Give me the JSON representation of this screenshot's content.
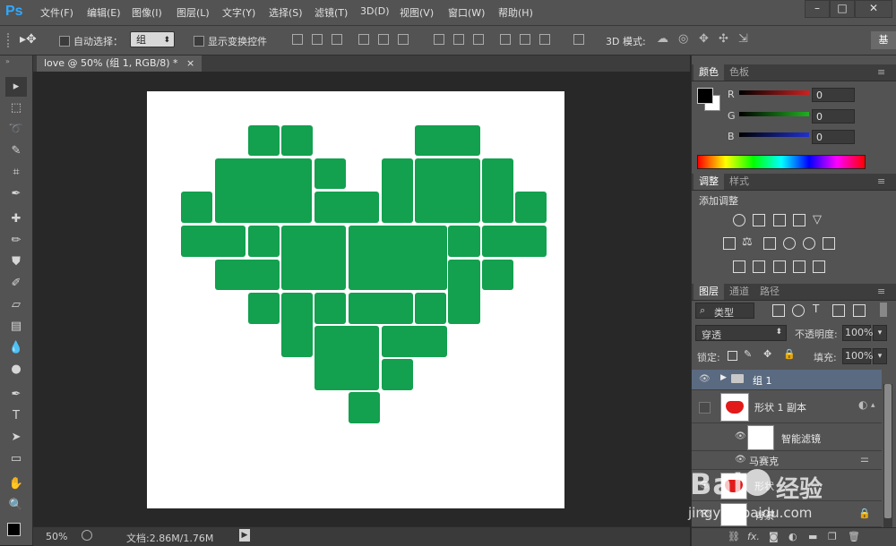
{
  "app": {
    "logo": "Ps",
    "menu": [
      "文件(F)",
      "编辑(E)",
      "图像(I)",
      "图层(L)",
      "文字(Y)",
      "选择(S)",
      "滤镜(T)",
      "3D(D)",
      "视图(V)",
      "窗口(W)",
      "帮助(H)"
    ],
    "window_controls": [
      "–",
      "□",
      "✕"
    ]
  },
  "options_bar": {
    "auto_select_label": "自动选择：",
    "auto_select_value": "组",
    "transform_controls_label": "显示变换控件",
    "mode_3d_label": "3D 模式:",
    "workspace_label": "基"
  },
  "document": {
    "tab_title": "love @ 50% (组 1, RGB/8) *",
    "tab_close": "×",
    "canvas_fill_color": "#13a04f",
    "zoom": "50%",
    "doc_size": "文档:2.86M/1.76M"
  },
  "color_panel": {
    "tabs": [
      "颜色",
      "色板"
    ],
    "channels": [
      {
        "label": "R",
        "value": "0",
        "color": "#d02020"
      },
      {
        "label": "G",
        "value": "0",
        "color": "#20b020"
      },
      {
        "label": "B",
        "value": "0",
        "color": "#2030d0"
      }
    ]
  },
  "adjustments_panel": {
    "tabs": [
      "调整",
      "样式"
    ],
    "heading": "添加调整"
  },
  "layers_panel": {
    "tabs": [
      "图层",
      "通道",
      "路径"
    ],
    "filter_kind": "类型",
    "blend_mode": "穿透",
    "opacity_label": "不透明度:",
    "opacity_value": "100%",
    "lock_label": "锁定:",
    "fill_label": "填充:",
    "fill_value": "100%",
    "layers": [
      {
        "name": "组 1",
        "type": "group",
        "visible": true,
        "selected": true
      },
      {
        "name": "形状 1 副本",
        "type": "shape",
        "visible": false,
        "selected": false
      },
      {
        "name": "智能滤镜",
        "type": "filter",
        "visible": true,
        "selected": false
      },
      {
        "name": "马赛克",
        "type": "filter-item",
        "visible": true,
        "selected": false
      },
      {
        "name": "形状",
        "type": "shape",
        "visible": true,
        "selected": false
      },
      {
        "name": "背景",
        "type": "background",
        "visible": true,
        "selected": false
      }
    ],
    "footer_icons": [
      "link-icon",
      "fx-icon",
      "mask-icon",
      "adjustment-icon",
      "folder-icon",
      "new-layer-icon",
      "trash-icon"
    ],
    "footer_fx_label": "fx."
  },
  "watermark": {
    "brand": "Bai",
    "brand_cn": "经验",
    "url": "jingyan.baidu.com"
  }
}
